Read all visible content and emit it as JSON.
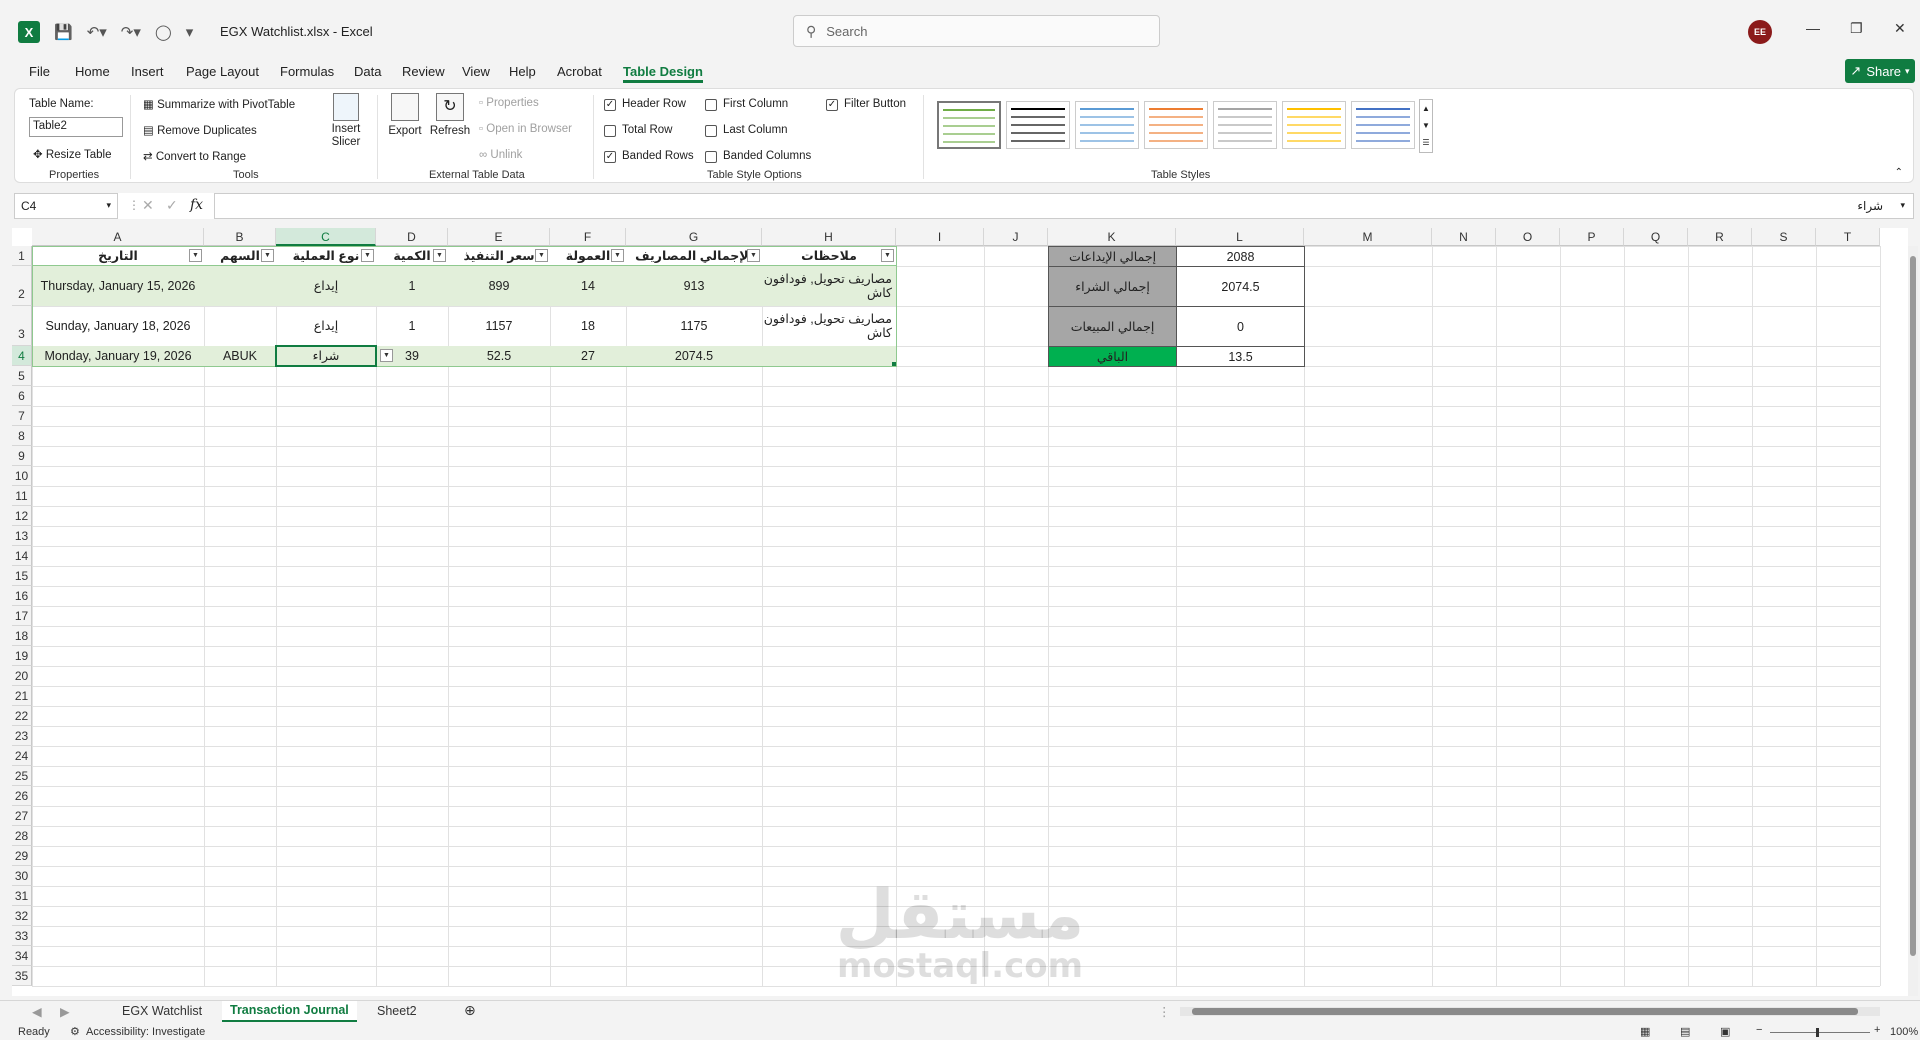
{
  "window": {
    "doc_title": "EGX Watchlist.xlsx  -  Excel",
    "search_placeholder": "Search",
    "avatar_initials": "EE"
  },
  "ribbon_tabs": [
    "File",
    "Home",
    "Insert",
    "Page Layout",
    "Formulas",
    "Data",
    "Review",
    "View",
    "Help",
    "Acrobat",
    "Table Design"
  ],
  "active_tab": "Table Design",
  "share_label": "Share",
  "ribbon": {
    "properties": {
      "table_name_label": "Table Name:",
      "table_name_value": "Table2",
      "resize_table": "Resize Table",
      "group_label": "Properties"
    },
    "tools": {
      "summarize": "Summarize with PivotTable",
      "remove_duplicates": "Remove Duplicates",
      "convert_range": "Convert to Range",
      "insert_slicer": "Insert Slicer",
      "group_label": "Tools"
    },
    "external": {
      "export": "Export",
      "refresh": "Refresh",
      "properties": "Properties",
      "open_browser": "Open in Browser",
      "unlink": "Unlink",
      "group_label": "External Table Data"
    },
    "style_options": {
      "header_row": "Header Row",
      "total_row": "Total Row",
      "banded_rows": "Banded Rows",
      "first_column": "First Column",
      "last_column": "Last Column",
      "banded_columns": "Banded Columns",
      "filter_button": "Filter Button",
      "group_label": "Table Style Options"
    },
    "table_styles": {
      "group_label": "Table Styles",
      "swatch_colors": [
        "#70ad47",
        "#000000",
        "#5b9bd5",
        "#ed7d31",
        "#a5a5a5",
        "#ffc000",
        "#4472c4"
      ]
    }
  },
  "formula_bar": {
    "name_box": "C4",
    "formula": "شراء"
  },
  "columns": [
    "A",
    "B",
    "C",
    "D",
    "E",
    "F",
    "G",
    "H",
    "I",
    "J",
    "K",
    "L",
    "M",
    "N",
    "O",
    "P",
    "Q",
    "R",
    "S",
    "T"
  ],
  "rows": [
    "1",
    "2",
    "3",
    "4",
    "5",
    "6",
    "7",
    "8",
    "9",
    "10",
    "11",
    "12",
    "13",
    "14",
    "15",
    "16",
    "17",
    "18",
    "19",
    "20",
    "21",
    "22",
    "23",
    "24",
    "25",
    "26",
    "27",
    "28",
    "29",
    "30",
    "31",
    "32",
    "33",
    "34",
    "35"
  ],
  "table": {
    "headers": [
      "التاريخ",
      "السهم",
      "نوع العملية",
      "الكمية",
      "سعر التنفيذ",
      "العمولة",
      "الإجمالي المصاريف",
      "ملاحظات"
    ],
    "rows": [
      [
        "Thursday, January 15, 2026",
        "",
        "إيداع",
        "1",
        "899",
        "14",
        "913",
        "مصاريف تحويل, فودافون كاش"
      ],
      [
        "Sunday, January 18, 2026",
        "",
        "إيداع",
        "1",
        "1157",
        "18",
        "1175",
        "مصاريف تحويل, فودافون كاش"
      ],
      [
        "Monday, January 19, 2026",
        "ABUK",
        "شراء",
        "39",
        "52.5",
        "27",
        "2074.5",
        ""
      ]
    ]
  },
  "summary": [
    {
      "label": "إجمالي الإيداعات",
      "value": "2088"
    },
    {
      "label": "إجمالي الشراء",
      "value": "2074.5"
    },
    {
      "label": "إجمالي المبيعات",
      "value": "0"
    },
    {
      "label": "الباقي",
      "value": "13.5"
    }
  ],
  "colors": {
    "accent": "#107c41",
    "band": "#e2efda",
    "summary_label_bg": "#a6a6a6",
    "remaining_bg": "#00b050"
  },
  "watermark": {
    "arabic": "مستقل",
    "latin": "mostaql.com"
  },
  "sheet_tabs": [
    "EGX Watchlist",
    "Transaction Journal",
    "Sheet2"
  ],
  "active_sheet": "Transaction Journal",
  "status": {
    "ready": "Ready",
    "accessibility": "Accessibility: Investigate",
    "zoom": "100%"
  }
}
